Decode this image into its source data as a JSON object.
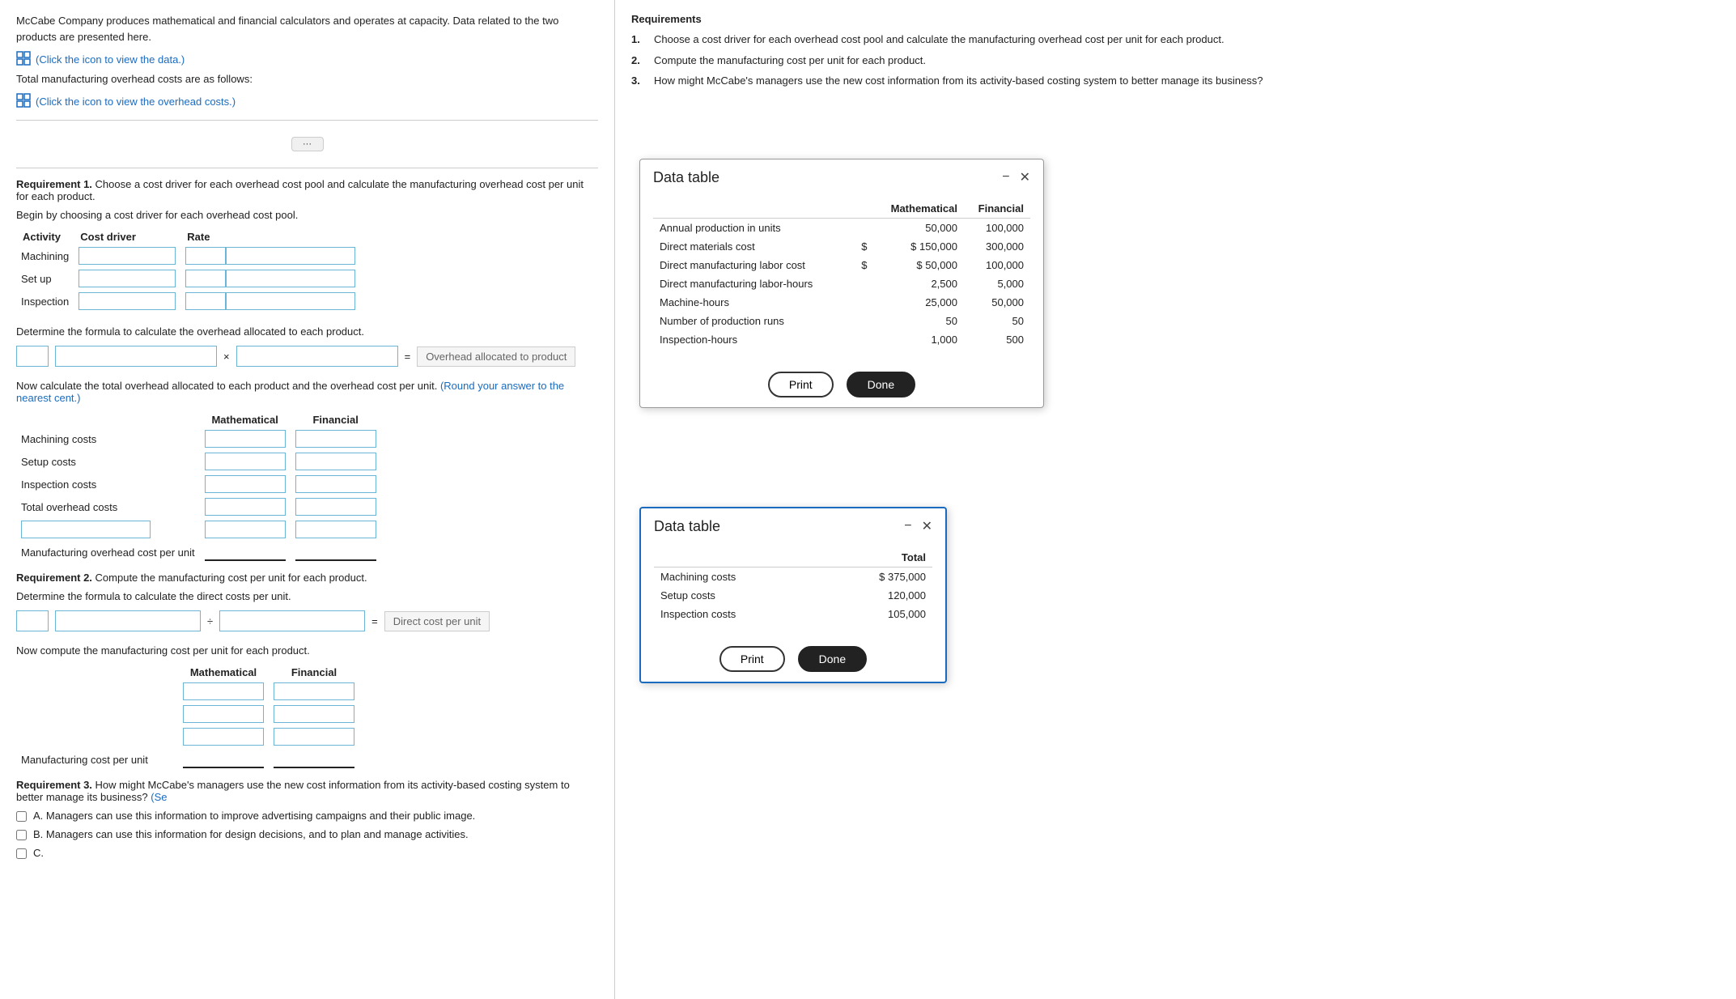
{
  "intro": {
    "text": "McCabe Company produces mathematical and financial calculators and operates at capacity. Data related to the two products are presented here.",
    "data_link": "(Click the icon to view the data.)",
    "overhead_label": "Total manufacturing overhead costs are as follows:",
    "overhead_link": "(Click the icon to view the overhead costs.)"
  },
  "requirements": {
    "heading": "Requirements",
    "items": [
      {
        "num": "1.",
        "text": "Choose a cost driver for each overhead cost pool and calculate the manufacturing overhead cost per unit for each product."
      },
      {
        "num": "2.",
        "text": "Compute the manufacturing cost per unit for each product."
      },
      {
        "num": "3.",
        "text": "How might McCabe's managers use the new cost information from its activity-based costing system to better manage its business?"
      }
    ]
  },
  "req1": {
    "title_bold": "Requirement 1.",
    "title_rest": " Choose a cost driver for each overhead cost pool and calculate the manufacturing overhead cost per unit for each product.",
    "subtitle": "Begin by choosing a cost driver for each overhead cost pool.",
    "table": {
      "headers": [
        "Activity",
        "Cost driver",
        "Rate"
      ],
      "rows": [
        {
          "activity": "Machining"
        },
        {
          "activity": "Set up"
        },
        {
          "activity": "Inspection"
        }
      ]
    },
    "formula_label": "Determine the formula to calculate the overhead allocated to each product.",
    "formula_result": "Overhead allocated to product",
    "formula_operator": "×",
    "formula_equals": "=",
    "overhead_label": "Now calculate the total overhead allocated to each product and the overhead cost per unit.",
    "round_note": "(Round your answer to the nearest cent.)",
    "overhead_table": {
      "headers": [
        "",
        "Mathematical",
        "Financial"
      ],
      "rows": [
        {
          "label": "Machining costs",
          "type": "normal"
        },
        {
          "label": "Setup costs",
          "type": "normal"
        },
        {
          "label": "Inspection costs",
          "type": "normal"
        },
        {
          "label": "Total overhead costs",
          "type": "normal"
        },
        {
          "label": "",
          "type": "input-only"
        },
        {
          "label": "Manufacturing overhead cost per unit",
          "type": "underline"
        }
      ]
    }
  },
  "req2": {
    "title_bold": "Requirement 2.",
    "title_rest": " Compute the manufacturing cost per unit for each product.",
    "subtitle": "Determine the formula to calculate the direct costs per unit.",
    "formula_operator": "÷",
    "formula_equals": "=",
    "formula_result": "Direct cost per unit",
    "overhead_label": "Now compute the manufacturing cost per unit for each product.",
    "mfg_table": {
      "headers": [
        "",
        "Mathematical",
        "Financial"
      ],
      "rows": [
        {
          "label": "",
          "type": "normal"
        },
        {
          "label": "",
          "type": "normal"
        },
        {
          "label": "",
          "type": "normal"
        },
        {
          "label": "Manufacturing cost per unit",
          "type": "underline"
        }
      ]
    }
  },
  "req3": {
    "title_bold": "Requirement 3.",
    "title_rest": " How might McCabe's managers use the new cost information from its activity-based costing system to better manage its business?",
    "note": "(Se",
    "options": [
      {
        "id": "A",
        "text": "A.  Managers can use this information to improve advertising campaigns and their public image."
      },
      {
        "id": "B",
        "text": "B.  Managers can use this information for design decisions, and to plan and manage activities."
      },
      {
        "id": "C",
        "text": "C."
      }
    ]
  },
  "modal1": {
    "title": "Data table",
    "table": {
      "headers": [
        "",
        "",
        "Mathematical",
        "Financial"
      ],
      "rows": [
        {
          "label": "Annual production in units",
          "symbol": "",
          "math": "50,000",
          "fin": "100,000"
        },
        {
          "label": "Direct materials cost",
          "symbol": "$",
          "math": "150,000",
          "fin": "300,000",
          "math_sym": "$"
        },
        {
          "label": "Direct manufacturing labor cost",
          "symbol": "$",
          "math": "50,000",
          "fin": "100,000",
          "math_sym": "$"
        },
        {
          "label": "Direct manufacturing labor-hours",
          "symbol": "",
          "math": "2,500",
          "fin": "5,000"
        },
        {
          "label": "Machine-hours",
          "symbol": "",
          "math": "25,000",
          "fin": "50,000"
        },
        {
          "label": "Number of production runs",
          "symbol": "",
          "math": "50",
          "fin": "50"
        },
        {
          "label": "Inspection-hours",
          "symbol": "",
          "math": "1,000",
          "fin": "500"
        }
      ]
    },
    "print_label": "Print",
    "done_label": "Done"
  },
  "modal2": {
    "title": "Data table",
    "table": {
      "headers": [
        "",
        "Total"
      ],
      "rows": [
        {
          "label": "Machining costs",
          "symbol": "$",
          "value": "375,000"
        },
        {
          "label": "Setup costs",
          "symbol": "",
          "value": "120,000"
        },
        {
          "label": "Inspection costs",
          "symbol": "",
          "value": "105,000"
        }
      ]
    },
    "print_label": "Print",
    "done_label": "Done"
  },
  "expand_dots": "···"
}
